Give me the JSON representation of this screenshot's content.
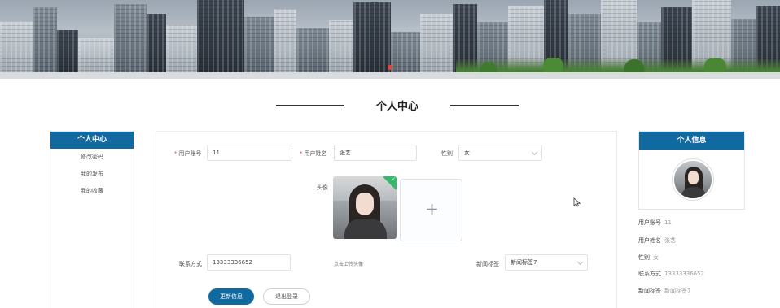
{
  "page": {
    "title": "个人中心"
  },
  "left_menu": {
    "header": "个人中心",
    "items": [
      "修改密码",
      "我的发布",
      "我的收藏"
    ]
  },
  "form": {
    "account_label": "用户账号",
    "account_value": "11",
    "name_label": "用户姓名",
    "name_value": "张艺",
    "gender_label": "性别",
    "gender_value": "女",
    "avatar_label": "头像",
    "upload_hint": "点击上传头像",
    "contact_label": "联系方式",
    "contact_value": "13333336652",
    "news_tag_label": "新闻标签",
    "news_tag_value": "新闻标签7",
    "update_button": "更新信息",
    "logout_button": "退出登录",
    "required_mark": "*"
  },
  "profile": {
    "header": "个人信息",
    "rows": [
      {
        "label": "用户账号",
        "value": "11"
      },
      {
        "label": "用户姓名",
        "value": "张艺"
      },
      {
        "label": "性别",
        "value": "女"
      },
      {
        "label": "联系方式",
        "value": "13333336652"
      },
      {
        "label": "新闻标签",
        "value": "新闻标签7"
      }
    ]
  },
  "colors": {
    "primary": "#10699f",
    "upload_ok": "#35b96a",
    "required": "#e24b4b"
  },
  "icons": {
    "upload": "plus-icon",
    "select_arrow": "chevron-down-icon",
    "upload_status": "check-icon",
    "pointer": "mouse-cursor-icon"
  }
}
